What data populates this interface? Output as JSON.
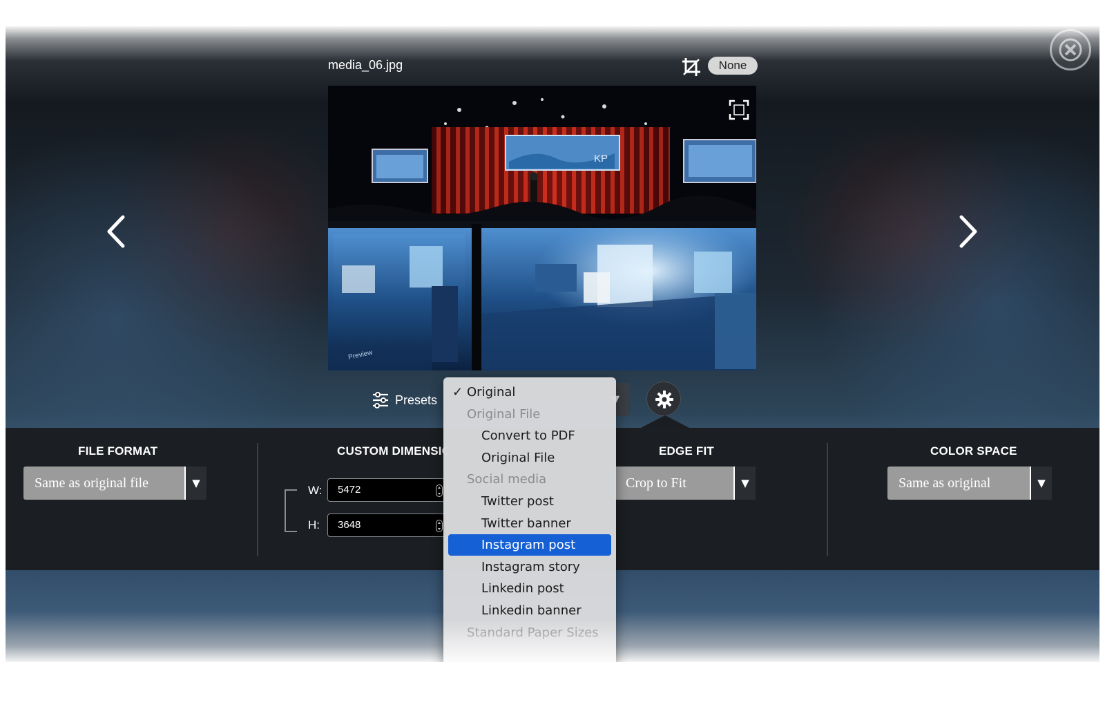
{
  "viewer": {
    "file_name": "media_06.jpg",
    "crop_badge": "None",
    "image_overlay_text": "Preview",
    "screen_logo": "KP"
  },
  "toolbar": {
    "presets_label": "Presets",
    "hidden_select_arrow": "▼"
  },
  "preset_dropdown": {
    "items": [
      {
        "label": "Original",
        "type": "option",
        "checked": true
      },
      {
        "label": "Original File",
        "type": "group"
      },
      {
        "label": "Convert to PDF",
        "type": "option"
      },
      {
        "label": "Original File",
        "type": "option"
      },
      {
        "label": "Social media",
        "type": "group"
      },
      {
        "label": "Twitter post",
        "type": "option"
      },
      {
        "label": "Twitter banner",
        "type": "option"
      },
      {
        "label": "Instagram post",
        "type": "option",
        "highlighted": true
      },
      {
        "label": "Instagram story",
        "type": "option"
      },
      {
        "label": "Linkedin post",
        "type": "option"
      },
      {
        "label": "Linkedin banner",
        "type": "option"
      },
      {
        "label": "Standard Paper Sizes",
        "type": "group"
      }
    ],
    "check_mark": "✓"
  },
  "options": {
    "file_format": {
      "title": "FILE FORMAT",
      "value": "Same as original file",
      "arrow": "▼"
    },
    "custom_dimensions": {
      "title": "CUSTOM DIMENSIONS",
      "w_label": "W:",
      "w_value": "5472",
      "h_label": "H:",
      "h_value": "3648"
    },
    "edge_fit": {
      "title": "EDGE FIT",
      "value": "Crop to Fit",
      "arrow": "▼"
    },
    "color_space": {
      "title": "COLOR SPACE",
      "value": "Same as original",
      "arrow": "▼"
    }
  },
  "colors": {
    "highlight": "#1660d6",
    "panel": "#1b1e22",
    "select_bg": "#9b9b9b"
  }
}
